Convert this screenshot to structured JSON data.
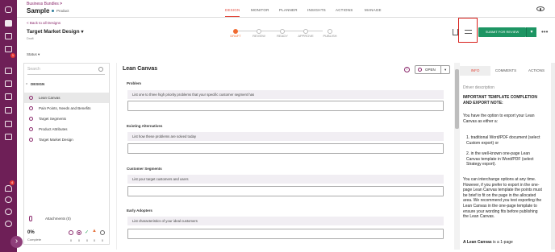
{
  "header": {
    "breadcrumb": "Business Bundles",
    "breadcrumb_sep": ">",
    "title": "Sample",
    "product_label": "Product",
    "tabs": [
      "DESIGN",
      "MONITOR",
      "PLANNER",
      "INSIGHTS",
      "ACTIONS",
      "MANAGE"
    ],
    "active_tab": "DESIGN"
  },
  "leftnav": {
    "badge_1": "1",
    "badge_2": "4"
  },
  "design": {
    "back_label": "< Back to all Designs",
    "title": "Target Market Design",
    "state": "Draft",
    "steps": [
      "DRAFT",
      "REVIEW",
      "READY",
      "APPROVE",
      "PUBLISH"
    ],
    "active_step": "DRAFT",
    "submit_label": "SUBMIT FOR REVIEW",
    "more_label": "•••"
  },
  "status_filter": "Status",
  "sidebar": {
    "search_placeholder": "Search",
    "section_label": "DESIGN",
    "items": [
      {
        "label": "Lean Canvas"
      },
      {
        "label": "Pain Points, Needs and Benefits"
      },
      {
        "label": "Target Segments"
      },
      {
        "label": "Product Attributes"
      },
      {
        "label": "Target Market Design"
      }
    ],
    "attachments_label": "Attachments (0)",
    "progress_percent": "0%",
    "progress_label": "Complete",
    "progress_counts": [
      "0",
      "0",
      "0",
      "0",
      "0"
    ],
    "colors": {
      "accent": "#8b2a6d"
    }
  },
  "canvas": {
    "title": "Lean Canvas",
    "open_label": "OPEN",
    "questions": [
      {
        "label": "Problem",
        "hint": "List one to three high priority problems that your specific customer segment has"
      },
      {
        "label": "Existing Alternatives",
        "hint": "List how these problems are solved today"
      },
      {
        "label": "Customer Segments",
        "hint": "List your target customers and users"
      },
      {
        "label": "Early Adopters",
        "hint": "List characteristics of your ideal customers"
      }
    ]
  },
  "right_panel": {
    "tabs": [
      "INFO",
      "COMMENTS",
      "ACTIONS"
    ],
    "active_tab": "INFO",
    "heading": "Driver description",
    "note_title": "IMPORTANT TEMPLATE COMPLETION AND EXPORT NOTE:",
    "para1": "You have the option to export your Lean Canvas as either a:",
    "list": [
      "traditional Word/PDF document (select Custom export) or",
      "in the well-known one-page Lean Canvas template in Word/PDF (select Strategy export)."
    ],
    "para2": "You can interchange options at any time. However, if you prefer to export in the one-page Lean Canvas template the points must be brief to fit on the page in the allocated area. We recommend you test exporting the Lean Canvas in the one-page template to ensure your wording fits before publishing the Lean Canvas.",
    "para3_bold": "A Lean Canvas",
    "para3_rest": " is a 1-page"
  }
}
